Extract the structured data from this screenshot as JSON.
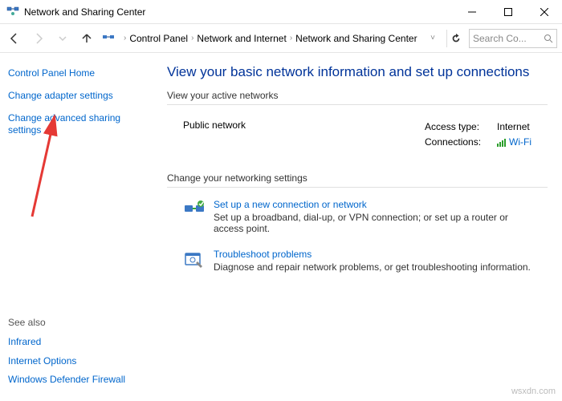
{
  "window": {
    "title": "Network and Sharing Center"
  },
  "breadcrumb": {
    "items": [
      {
        "label": "Control Panel"
      },
      {
        "label": "Network and Internet"
      },
      {
        "label": "Network and Sharing Center"
      }
    ]
  },
  "search": {
    "placeholder": "Search Co..."
  },
  "sidebar": {
    "home": "Control Panel Home",
    "links": [
      {
        "label": "Change adapter settings"
      },
      {
        "label": "Change advanced sharing settings"
      }
    ],
    "see_also_header": "See also",
    "see_also": [
      {
        "label": "Infrared"
      },
      {
        "label": "Internet Options"
      },
      {
        "label": "Windows Defender Firewall"
      }
    ]
  },
  "main": {
    "title": "View your basic network information and set up connections",
    "active_header": "View your active networks",
    "active_net": {
      "name": "Public network",
      "access_label": "Access type:",
      "access_val": "Internet",
      "conn_label": "Connections:",
      "conn_val": "Wi-Fi"
    },
    "change_header": "Change your networking settings",
    "items": [
      {
        "link": "Set up a new connection or network",
        "desc": "Set up a broadband, dial-up, or VPN connection; or set up a router or access point."
      },
      {
        "link": "Troubleshoot problems",
        "desc": "Diagnose and repair network problems, or get troubleshooting information."
      }
    ]
  },
  "watermark": "wsxdn.com"
}
